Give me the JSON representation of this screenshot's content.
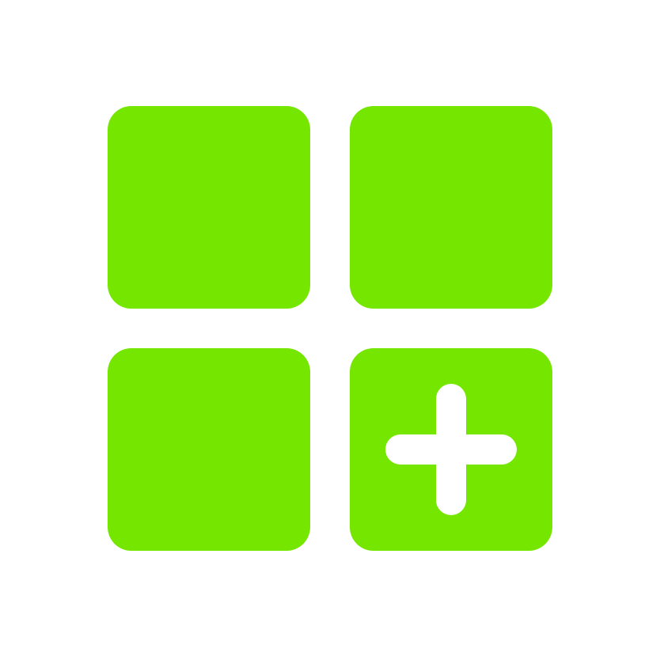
{
  "icon": {
    "name": "add-app-grid-icon",
    "color": "#74E600",
    "background": "#FFFFFF",
    "tiles": [
      {
        "name": "tile-top-left-icon",
        "glyph": "square"
      },
      {
        "name": "tile-top-right-icon",
        "glyph": "square"
      },
      {
        "name": "tile-bottom-left-icon",
        "glyph": "square"
      },
      {
        "name": "tile-bottom-right-icon",
        "glyph": "plus",
        "glyph_color": "#FFFFFF"
      }
    ]
  }
}
